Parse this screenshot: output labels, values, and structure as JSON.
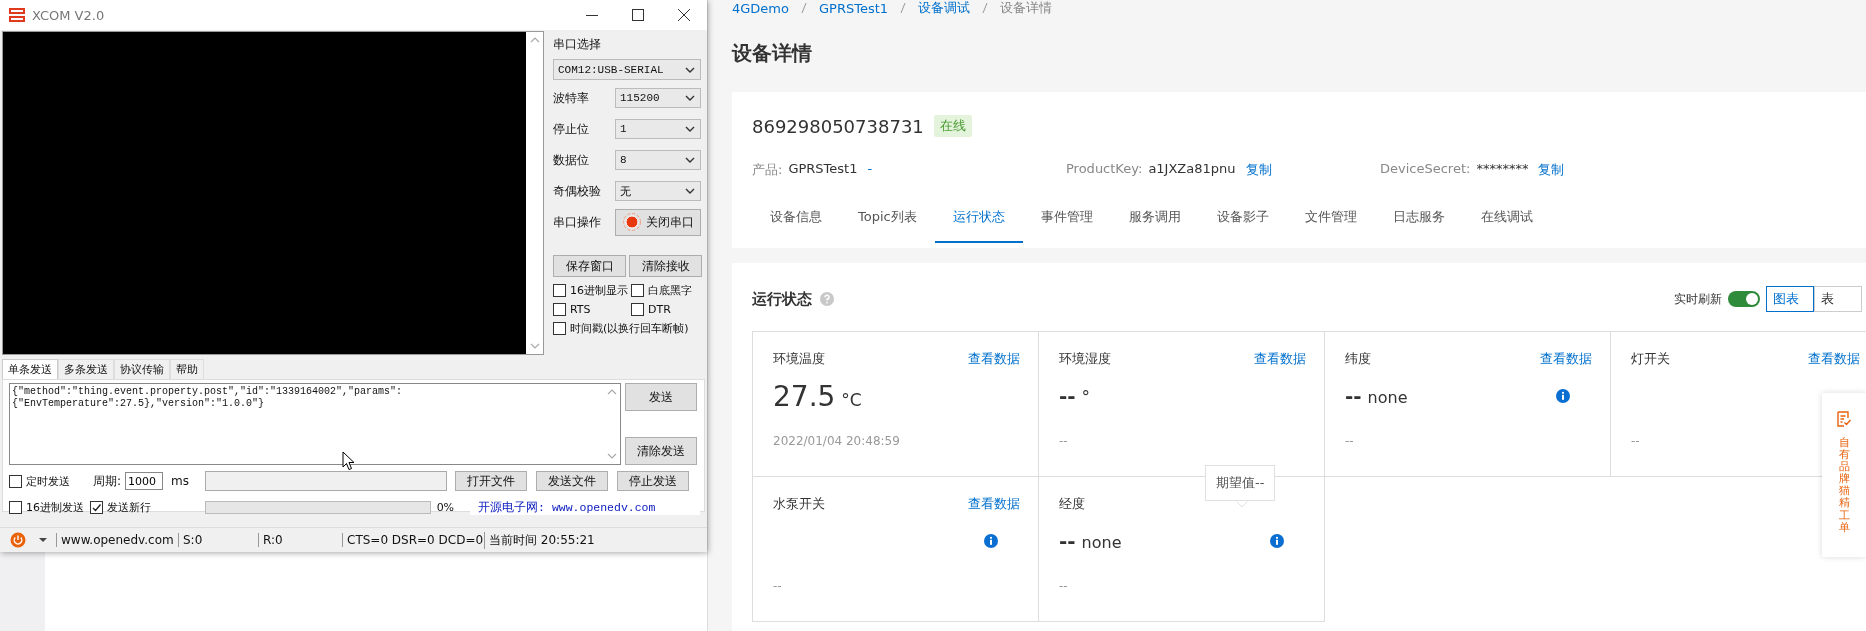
{
  "xcom": {
    "title": "XCOM V2.0",
    "port": {
      "label": "串口选择",
      "value": "COM12:USB-SERIAL"
    },
    "settings": [
      {
        "label": "波特率",
        "value": "115200"
      },
      {
        "label": "停止位",
        "value": "1"
      },
      {
        "label": "数据位",
        "value": "8"
      },
      {
        "label": "奇偶校验",
        "value": "无"
      }
    ],
    "port_operation": {
      "label": "串口操作",
      "button": "关闭串口",
      "open": true
    },
    "receive_buttons": [
      "保存窗口",
      "清除接收"
    ],
    "receive_options": [
      {
        "label": "16进制显示",
        "checked": false
      },
      {
        "label": "白底黑字",
        "checked": false
      },
      {
        "label": "RTS",
        "checked": false
      },
      {
        "label": "DTR",
        "checked": false
      },
      {
        "label": "时间戳(以换行回车断帧)",
        "checked": false
      }
    ],
    "tabs": [
      {
        "label": "单条发送",
        "selected": true
      },
      {
        "label": "多条发送",
        "selected": false
      },
      {
        "label": "协议传输",
        "selected": false
      },
      {
        "label": "帮助",
        "selected": false
      }
    ],
    "send_lines": [
      "{\"method\":\"thing.event.property.post\",\"id\":\"1339164002\",\"params\":",
      "{\"EnvTemperature\":27.5},\"version\":\"1.0.0\"}"
    ],
    "send_buttons": [
      "发送",
      "清除发送"
    ],
    "timed_send": {
      "label": "定时发送",
      "checked": false
    },
    "period": {
      "label": "周期:",
      "value": "1000",
      "unit": "ms"
    },
    "file_buttons": [
      "打开文件",
      "发送文件",
      "停止发送"
    ],
    "hex_send": {
      "label": "16进制发送",
      "checked": false
    },
    "send_newline": {
      "label": "发送新行",
      "checked": true
    },
    "progress": {
      "level": 0,
      "reading": "0%"
    },
    "banner": "开源电子网: www.openedv.com",
    "status_bar": [
      "www.openedv.com",
      "S:0",
      "R:0",
      "CTS=0 DSR=0 DCD=0",
      "当前时间 20:55:21"
    ]
  },
  "page": {
    "breadcrumb": [
      {
        "label": "4GDemo",
        "link": true
      },
      {
        "label": "GPRSTest1",
        "link": true
      },
      {
        "label": "设备调试",
        "link": true
      },
      {
        "label": "设备详情",
        "link": false
      }
    ],
    "title": "设备详情",
    "device": {
      "name": "869298050738731",
      "status": "在线",
      "online": true
    },
    "info": [
      {
        "label": "产品:",
        "value": "GPRSTest1",
        "action": "-"
      },
      {
        "label": "ProductKey:",
        "value": "a1JXZa81pnu",
        "action": "复制"
      },
      {
        "label": "DeviceSecret:",
        "value": "********",
        "action": "复制"
      }
    ],
    "tabs": [
      {
        "label": "设备信息",
        "selected": false
      },
      {
        "label": "Topic列表",
        "selected": false
      },
      {
        "label": "运行状态",
        "selected": true
      },
      {
        "label": "事件管理",
        "selected": false
      },
      {
        "label": "服务调用",
        "selected": false
      },
      {
        "label": "设备影子",
        "selected": false
      },
      {
        "label": "文件管理",
        "selected": false
      },
      {
        "label": "日志服务",
        "selected": false
      },
      {
        "label": "在线调试",
        "selected": false
      }
    ],
    "status_section": {
      "title": "运行状态",
      "realtime_label": "实时刷新",
      "realtime_on": true,
      "view_buttons": [
        {
          "label": "图表",
          "selected": true
        },
        {
          "label": "表",
          "selected": false
        }
      ]
    },
    "properties": [
      {
        "name": "环境温度",
        "link": "查看数据",
        "value": "27.5",
        "unit": "°C",
        "time": "2022/01/04 20:48:59",
        "info": false
      },
      {
        "name": "环境湿度",
        "link": "查看数据",
        "value": "--",
        "unit": "°",
        "time": "--",
        "info": false
      },
      {
        "name": "纬度",
        "link": "查看数据",
        "value": "--",
        "unit": "none",
        "time": "--",
        "info": true
      },
      {
        "name": "灯开关",
        "link": "查看数据",
        "time": "--",
        "info": false
      },
      {
        "name": "水泵开关",
        "link": "查看数据",
        "time": "--",
        "info": true
      },
      {
        "name": "经度",
        "value": "--",
        "unit": "none",
        "time": "--",
        "info": true,
        "tooltip": "期望值--"
      }
    ],
    "side_widget": "自有品牌猫精工单"
  }
}
